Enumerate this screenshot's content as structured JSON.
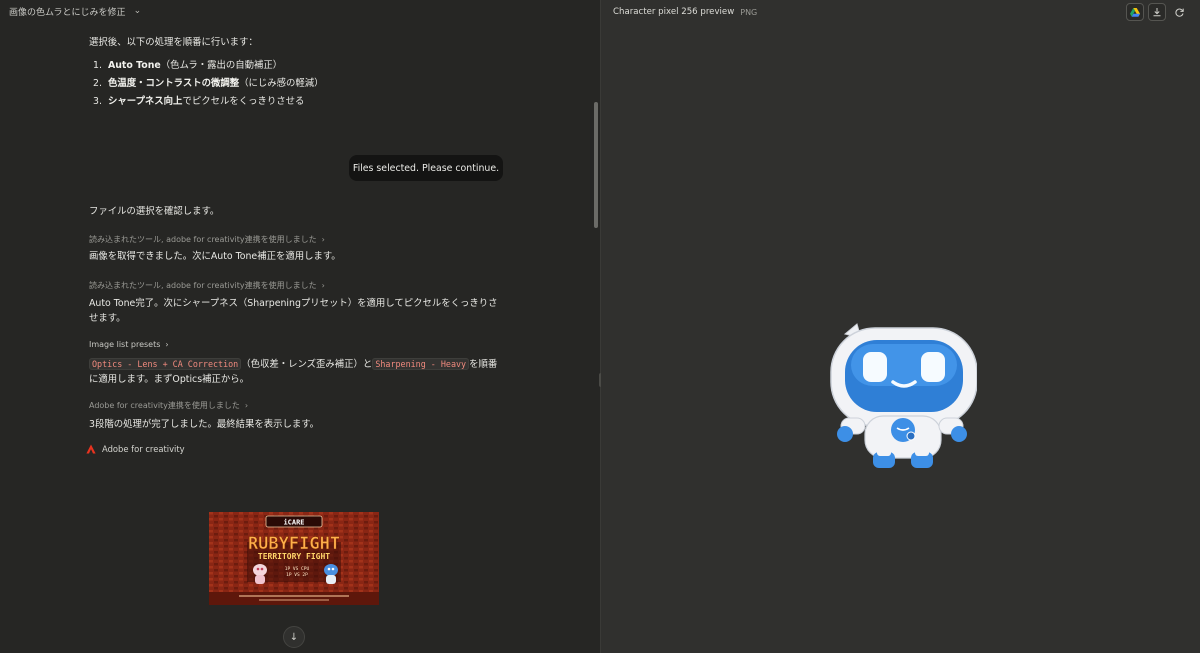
{
  "topbar": {
    "title": "画像の色ムラとにじみを修正"
  },
  "chat": {
    "intro": "選択後、以下の処理を順番に行います：",
    "steps": [
      {
        "num": "1.",
        "bold": "Auto Tone",
        "rest": "（色ムラ・露出の自動補正）"
      },
      {
        "num": "2.",
        "bold": "色温度・コントラストの微調整",
        "rest": "（にじみ感の軽減）"
      },
      {
        "num": "3.",
        "bold": "シャープネス向上",
        "rest": "でピクセルをくっきりさせる"
      }
    ],
    "user_bubble": "Files selected. Please continue.",
    "confirm": "ファイルの選択を確認します。",
    "tool1": "読み込まれたツール, adobe for creativity連携を使用しました",
    "msg1": "画像を取得できました。次にAuto Tone補正を適用します。",
    "tool2": "読み込まれたツール, adobe for creativity連携を使用しました",
    "msg2": "Auto Tone完了。次にシャープネス（Sharpeningプリセット）を適用してピクセルをくっきりさせます。",
    "tool3": "Image list presets",
    "msg3": {
      "code1": "Optics - Lens + CA Correction",
      "mid": "（色収差・レンズ歪み補正）と",
      "code2": "Sharpening - Heavy",
      "end": "を順番に適用します。まずOptics補正から。"
    },
    "tool4": "Adobe for creativity連携を使用しました",
    "msg4": "3段階の処理が完了しました。最終結果を表示します。",
    "app_label": "Adobe for creativity",
    "poster": {
      "badge": "iCARE",
      "title": "RUBYFIGHT",
      "subtitle": "TERRITORY FIGHT",
      "line1": "1P VS CPU",
      "line2": "1P VS 2P"
    }
  },
  "preview": {
    "title": "Character pixel 256 preview",
    "format": "PNG",
    "accent": "#3a8ee0"
  }
}
